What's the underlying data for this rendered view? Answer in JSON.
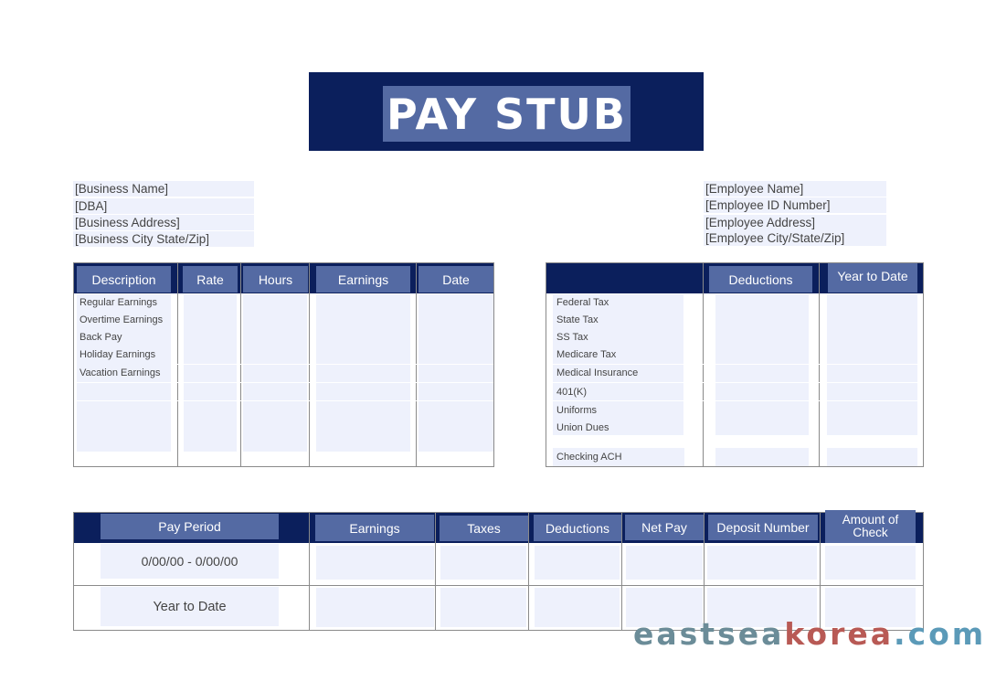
{
  "title": "PAY STUB",
  "business": {
    "name": "[Business Name]",
    "dba": "[DBA]",
    "address": "[Business Address]",
    "city": "[Business City State/Zip]"
  },
  "employee": {
    "name": "[Employee Name]",
    "id": "[Employee ID Number]",
    "address": "[Employee Address]",
    "city": "[Employee City/State/Zip]"
  },
  "earnings_table": {
    "headers": [
      "Description",
      "Rate",
      "Hours",
      "Earnings",
      "Date"
    ],
    "rows": [
      "Regular Earnings",
      "Overtime Earnings",
      "Back Pay",
      "Holiday Earnings",
      "Vacation Earnings"
    ]
  },
  "deductions_table": {
    "headers": [
      "",
      "Deductions",
      "Year to Date"
    ],
    "rows": [
      "Federal Tax",
      "State Tax",
      "SS Tax",
      "Medicare Tax",
      "Medical Insurance",
      "401(K)",
      "Uniforms",
      "Union Dues"
    ],
    "footer_row": "Checking ACH"
  },
  "summary_table": {
    "headers": [
      "Pay Period",
      "Earnings",
      "Taxes",
      "Deductions",
      "Net Pay",
      "Deposit Number",
      "Amount of Check"
    ],
    "rows": [
      "0/00/00 - 0/00/00",
      "Year to Date"
    ]
  },
  "watermark": {
    "part1": "eastsea",
    "part2": "korea",
    "part3": ".com"
  }
}
